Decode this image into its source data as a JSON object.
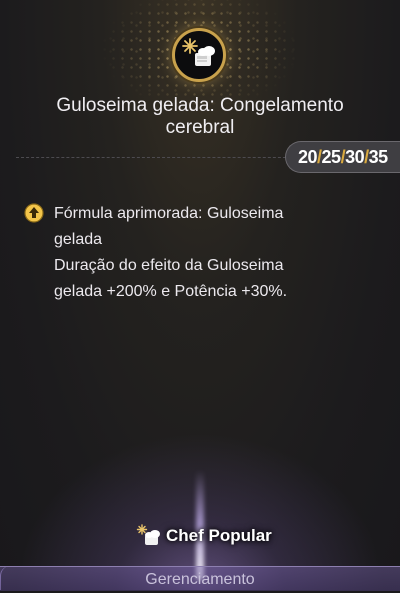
{
  "skill": {
    "title": "Guloseima gelada: Congelamento cerebral",
    "icon": "frozen-treat-icon",
    "levels": [
      "20",
      "25",
      "30",
      "35"
    ],
    "level_separator": "/"
  },
  "effect": {
    "icon": "upgrade-arrow-icon",
    "line1": "Fórmula aprimorada: Guloseima",
    "line2": "gelada",
    "line3": "Duração do efeito da Guloseima",
    "line4": "gelada +200% e Potência +30%."
  },
  "badge": {
    "icon": "chef-icon",
    "label": "Chef Popular"
  },
  "footer": {
    "tab_label": "Gerenciamento"
  },
  "colors": {
    "accent_gold": "#c9a24c",
    "level_separator": "#d9a93f",
    "footer_purple": "#8d7fb0"
  }
}
